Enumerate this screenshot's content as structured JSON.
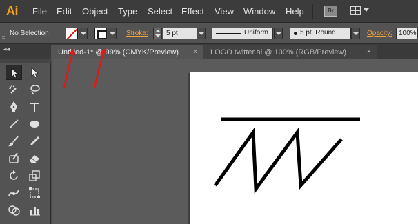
{
  "app": {
    "logo": "Ai",
    "brand_color": "#f7a11c"
  },
  "menu": [
    "File",
    "Edit",
    "Object",
    "Type",
    "Select",
    "Effect",
    "View",
    "Window",
    "Help"
  ],
  "app_bar": {
    "bridge_label": "Br",
    "workspace_icon": "grid-layout-icon"
  },
  "control_bar": {
    "selection_status": "No Selection",
    "fill_swatch": "none-fill",
    "stroke_swatch": "black-stroke",
    "stroke_label": "Stroke:",
    "stroke_weight": "5 pt",
    "variable_width_profile": "Uniform",
    "brush": "5 pt. Round",
    "opacity_label": "Opacity:",
    "opacity": "100%"
  },
  "tabs": [
    {
      "label": "Untitled-1* @ 99% (CMYK/Preview)",
      "active": true,
      "close": "×"
    },
    {
      "label": "LOGO twitter.ai @ 100% (RGB/Preview)",
      "active": false,
      "close": "×"
    }
  ],
  "tools_panel": {
    "collapse_label": "◂◂",
    "tools": [
      "selection-tool",
      "direct-selection-tool",
      "magic-wand-tool",
      "lasso-tool",
      "pen-tool",
      "type-tool",
      "line-segment-tool",
      "ellipse-tool",
      "paintbrush-tool",
      "pencil-tool",
      "blob-brush-tool",
      "eraser-tool",
      "rotate-tool",
      "scale-tool",
      "width-tool",
      "free-transform-tool",
      "shape-builder-tool",
      "graph-tool"
    ]
  },
  "colors": {
    "annotation": "#e01818",
    "accent_label": "#f2a43a"
  }
}
